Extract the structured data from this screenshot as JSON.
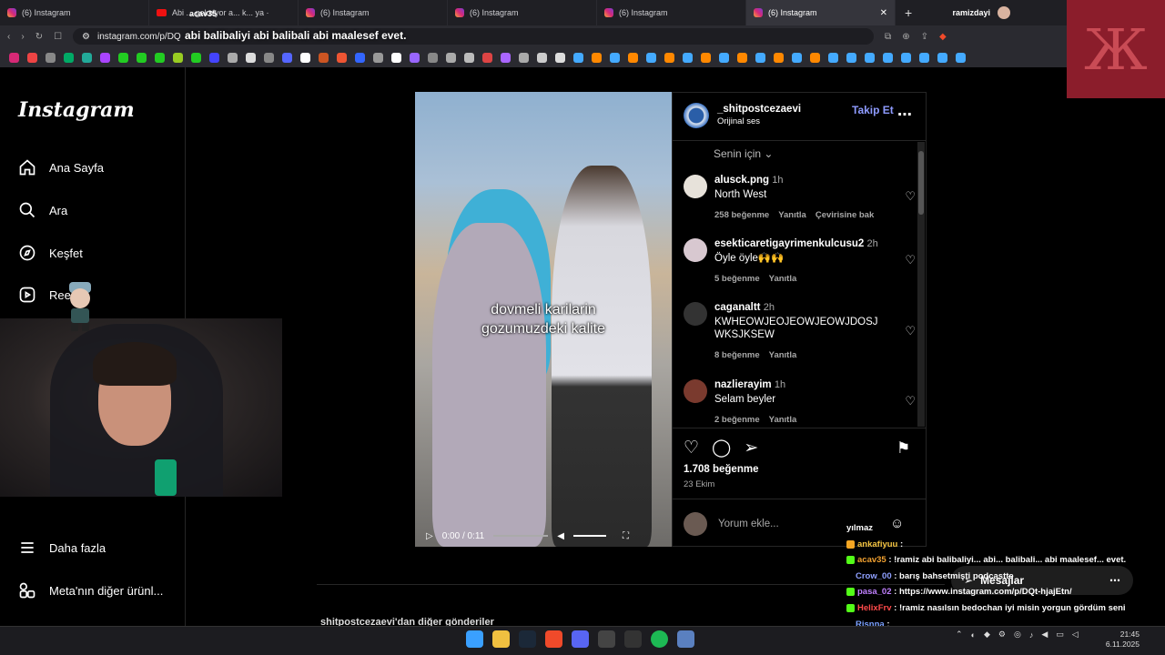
{
  "browser": {
    "tabs": [
      {
        "label": "(6) Instagram",
        "icon": "instagram-icon"
      },
      {
        "label": "Abi ... gelmiyor a... k... ya ·",
        "icon": "youtube-icon"
      },
      {
        "label": "(6) Instagram",
        "icon": "instagram-icon"
      },
      {
        "label": "(6) Instagram",
        "icon": "instagram-icon"
      },
      {
        "label": "(6) Instagram",
        "icon": "instagram-icon"
      },
      {
        "label": "(6) Instagram",
        "icon": "instagram-icon",
        "active": true
      }
    ],
    "new_tab": "+",
    "profile_name": "ramizdayi",
    "url": "instagram.com/p/DQ",
    "overlay_user": "acav35",
    "overlay_text": "abi balibaliyi abi balibali abi maalesef evet."
  },
  "sidebar": {
    "logo": "Instagram",
    "items": [
      {
        "label": "Ana Sayfa",
        "icon": "home-icon"
      },
      {
        "label": "Ara",
        "icon": "search-icon"
      },
      {
        "label": "Keşfet",
        "icon": "compass-icon"
      },
      {
        "label": "Reels",
        "icon": "reels-icon"
      },
      {
        "label": "Daha fazla",
        "icon": "menu-icon"
      },
      {
        "label": "Meta'nın diğer ürünl...",
        "icon": "apps-icon"
      }
    ]
  },
  "post": {
    "author": "_shitpostcezaevi",
    "audio": "Orijinal ses",
    "follow": "Takip Et",
    "caption_line1": "dovmeli karilarin",
    "caption_line2": "gozumuzdeki kalite",
    "video_time": "0:00 / 0:11",
    "sort_label": "Senin için",
    "likes": "1.708 beğenme",
    "date": "23 Ekim",
    "comment_placeholder": "Yorum ekle...",
    "more_posts": "shitpostcezaevi'dan diğer gönderiler",
    "comments": [
      {
        "user": "alusck.png",
        "time": "1h",
        "text": "North West",
        "meta": [
          "258 beğenme",
          "Yanıtla",
          "Çevirisine bak"
        ]
      },
      {
        "user": "esekticaretigayrimenkulcusu2",
        "time": "2h",
        "text": "Öyle öyle🙌🙌",
        "meta": [
          "5 beğenme",
          "Yanıtla"
        ]
      },
      {
        "user": "caganaltt",
        "time": "2h",
        "text": "KWHEOWJEOJEOWJEOWJDOSJWKSJKSEW",
        "meta": [
          "8 beğenme",
          "Yanıtla"
        ]
      },
      {
        "user": "nazlierayim",
        "time": "1h",
        "text": "Selam beyler",
        "meta": [
          "2 beğenme",
          "Yanıtla"
        ]
      }
    ]
  },
  "messages_pill": "Mesajlar",
  "chat": [
    {
      "user": "",
      "text": "yılmaz",
      "color": "#ffffff"
    },
    {
      "user": "ankafiyuu",
      "text": ":",
      "color": "#f5c542"
    },
    {
      "user": "acav35",
      "text": ": !ramiz abi balibaliyi... abi... balibali... abi maalesef... evet.",
      "color": "#f0a030"
    },
    {
      "user": "Crow_00",
      "text": ": barış bahsetmişti podcastte",
      "color": "#8fa0ff"
    },
    {
      "user": "pasa_02",
      "text": ": https://www.instagram.com/p/DQt-hjajEtn/",
      "color": "#c080ff"
    },
    {
      "user": "HelixFrv",
      "text": ": !ramiz nasılsın bedochan iyi misin yorgun gördüm seni",
      "color": "#ff4a4a"
    },
    {
      "user": "Risnna",
      "text": ":",
      "color": "#7aa0ff"
    }
  ],
  "clock": {
    "time": "21:45",
    "date": "6.11.2025"
  }
}
